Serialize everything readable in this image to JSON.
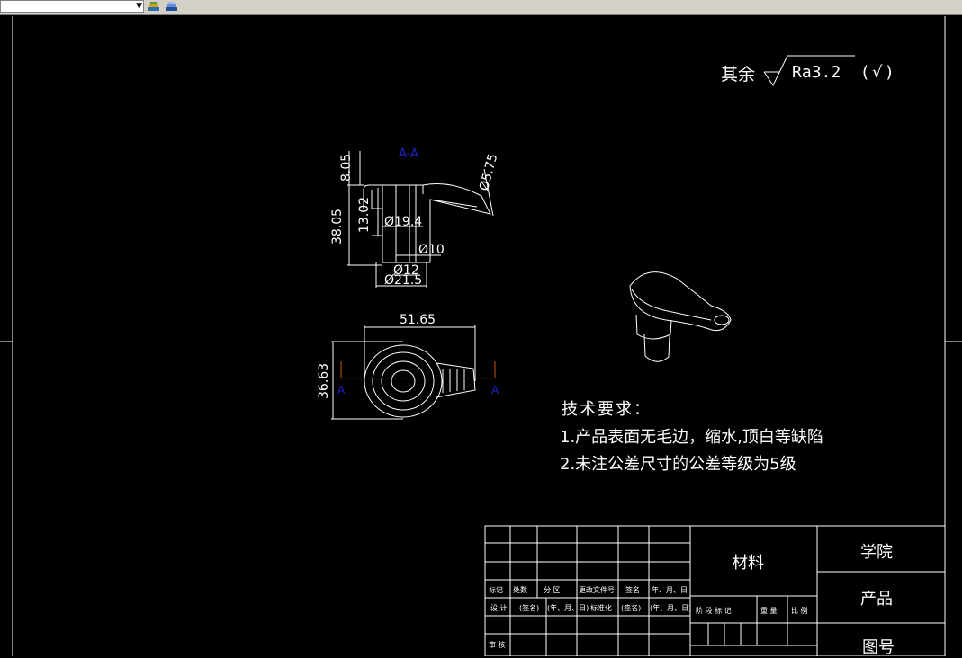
{
  "window": {
    "toolbar": {
      "layer_value": "",
      "icons": [
        "layer-states-icon",
        "layer-previous-icon"
      ]
    }
  },
  "drawing": {
    "roughness": {
      "prefix": "其余",
      "value": "Ra3.2",
      "suffix": "(√)"
    },
    "section_label": "A-A",
    "dims": {
      "top_height": "8.05",
      "total_height": "38.05",
      "mid_height": "13.02",
      "d19_4": "Ø19.4",
      "d10": "Ø10",
      "d12": "Ø12",
      "d21_5": "Ø21.5",
      "d5_75": "Ø5.75",
      "width": "51.65",
      "height": "36.63",
      "cut_left": "A",
      "cut_right": "A"
    },
    "notes": {
      "title": "技术要求：",
      "line1": "1.产品表面无毛边，缩水,顶白等缺陷",
      "line2": "2.未注公差尺寸的公差等级为5级"
    },
    "title_block": {
      "row_mark": "标记",
      "row_count": "处数",
      "row_zone": "分 区",
      "row_docno": "更改文件号",
      "row_sign": "签名",
      "row_date": "年、月、日",
      "design": "设 计",
      "sign1": "(签名)",
      "date1": "(年、月、日)",
      "standard": "标准化",
      "sign2": "(签名)",
      "date2": "(年、月、日)",
      "review": "审 核",
      "material": "材料",
      "stage": "阶 段 标 记",
      "weight": "重 量",
      "scale": "比 例",
      "school": "学院",
      "product": "产品",
      "drawing_no": "图号"
    },
    "colors": {
      "background": "#000000",
      "lines": "#ffffff",
      "section_text": "#2222cc",
      "cut_arrow": "#cc5500"
    }
  }
}
